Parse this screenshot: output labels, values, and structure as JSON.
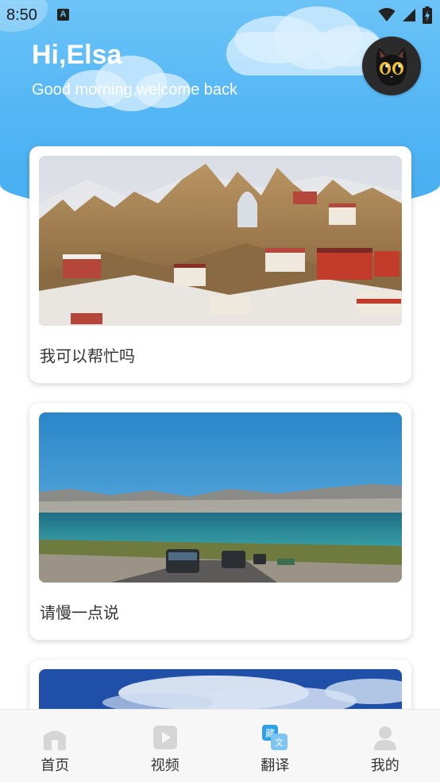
{
  "status_bar": {
    "time": "8:50",
    "notification_icon": "a-badge-icon",
    "wifi_icon": "wifi-icon",
    "signal_icon": "cell-signal-icon",
    "battery_icon": "battery-charging-icon"
  },
  "header": {
    "title": "Hi,Elsa",
    "subtitle": "Good morning,welcome back",
    "avatar_icon": "black-cat-avatar-icon",
    "gradient_top": "#6cc3f7",
    "gradient_bottom": "#48aef0"
  },
  "cards": [
    {
      "label": "我可以帮忙吗",
      "image": "monastery-cliff-photo"
    },
    {
      "label": "请慢一点说",
      "image": "lake-road-cars-photo"
    },
    {
      "label": "",
      "image": "blue-sky-clouds-birds-photo"
    }
  ],
  "bottom_nav": {
    "items": [
      {
        "label": "首页",
        "icon": "home-icon",
        "active": false
      },
      {
        "label": "视频",
        "icon": "video-play-icon",
        "active": false
      },
      {
        "label": "翻译",
        "icon": "translate-icon",
        "active": true
      },
      {
        "label": "我的",
        "icon": "user-profile-icon",
        "active": false
      }
    ]
  },
  "colors": {
    "accent_blue": "#2f9fe8",
    "card_text": "#333333",
    "nav_inactive_icon": "#d5d5d5"
  }
}
